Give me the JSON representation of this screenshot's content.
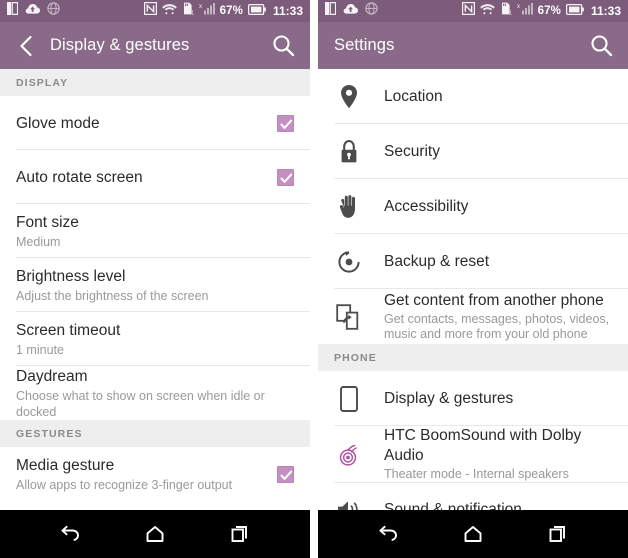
{
  "status_bar": {
    "left_icons": [
      "sim-card-icon",
      "cloud-upload-icon",
      "globe-icon"
    ],
    "right_icons": [
      "nfc-icon",
      "wifi-icon",
      "sd-card-icon",
      "signal-icon"
    ],
    "battery_percent": "67%",
    "time": "11:33"
  },
  "left_screen": {
    "action_bar": {
      "title": "Display & gestures",
      "back_icon": "back-arrow-icon",
      "search_icon": "search-icon"
    },
    "sections": [
      {
        "header": "DISPLAY",
        "items": [
          {
            "title": "Glove mode",
            "subtitle": "",
            "checkbox": true,
            "checked": true
          },
          {
            "title": "Auto rotate screen",
            "subtitle": "",
            "checkbox": true,
            "checked": true
          },
          {
            "title": "Font size",
            "subtitle": "Medium",
            "checkbox": false,
            "checked": false
          },
          {
            "title": "Brightness level",
            "subtitle": "Adjust the brightness of the screen",
            "checkbox": false,
            "checked": false
          },
          {
            "title": "Screen timeout",
            "subtitle": "1 minute",
            "checkbox": false,
            "checked": false
          },
          {
            "title": "Daydream",
            "subtitle": "Choose what to show on screen when idle or docked",
            "checkbox": false,
            "checked": false
          }
        ]
      },
      {
        "header": "GESTURES",
        "items": [
          {
            "title": "Media gesture",
            "subtitle": "Allow apps to recognize 3-finger output",
            "checkbox": true,
            "checked": true
          }
        ]
      }
    ]
  },
  "right_screen": {
    "action_bar": {
      "title": "Settings",
      "search_icon": "search-icon"
    },
    "sections": [
      {
        "header": "",
        "items": [
          {
            "icon": "location-pin-icon",
            "title": "Location",
            "subtitle": ""
          },
          {
            "icon": "lock-icon",
            "title": "Security",
            "subtitle": ""
          },
          {
            "icon": "hand-icon",
            "title": "Accessibility",
            "subtitle": ""
          },
          {
            "icon": "backup-reset-icon",
            "title": "Backup & reset",
            "subtitle": ""
          },
          {
            "icon": "transfer-phone-icon",
            "title": "Get content from another phone",
            "subtitle": "Get contacts, messages, photos, videos, music and more from your old phone"
          }
        ]
      },
      {
        "header": "PHONE",
        "items": [
          {
            "icon": "phone-display-icon",
            "title": "Display & gestures",
            "subtitle": ""
          },
          {
            "icon": "boomsound-icon",
            "title": "HTC BoomSound with Dolby Audio",
            "subtitle": "Theater mode - Internal speakers"
          },
          {
            "icon": "speaker-icon",
            "title": "Sound & notification",
            "subtitle": ""
          }
        ]
      }
    ]
  },
  "nav_bar": {
    "buttons": [
      {
        "name": "back-button",
        "icon": "back-curve-icon"
      },
      {
        "name": "home-button",
        "icon": "home-icon"
      },
      {
        "name": "recents-button",
        "icon": "recents-icon"
      }
    ]
  },
  "colors": {
    "status_bar": "#7d5b7b",
    "action_bar": "#8a6a89",
    "checkbox": "#c490c2",
    "section_header_bg": "#eeeeee",
    "nav_bar": "#000000",
    "accent_boomsound": "#b0529f"
  }
}
